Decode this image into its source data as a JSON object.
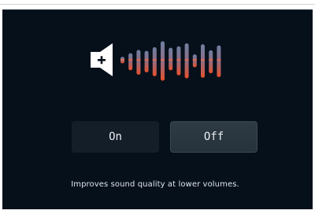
{
  "icons": {
    "speaker": "speaker-plus-icon"
  },
  "visualizer": {
    "bars": [
      {
        "upper": 0.1,
        "lower": 0.12
      },
      {
        "upper": 0.22,
        "lower": 0.35
      },
      {
        "upper": 0.33,
        "lower": 0.5
      },
      {
        "upper": 0.3,
        "lower": 0.42
      },
      {
        "upper": 0.42,
        "lower": 0.55
      },
      {
        "upper": 0.62,
        "lower": 0.7
      },
      {
        "upper": 0.4,
        "lower": 0.35
      },
      {
        "upper": 0.45,
        "lower": 0.52
      },
      {
        "upper": 0.55,
        "lower": 0.62
      },
      {
        "upper": 0.18,
        "lower": 0.25
      },
      {
        "upper": 0.52,
        "lower": 0.6
      },
      {
        "upper": 0.32,
        "lower": 0.45
      },
      {
        "upper": 0.48,
        "lower": 0.58
      }
    ],
    "colors": {
      "upper": "#6e7fa0",
      "lower": "#e8502a",
      "midline": "#ff6a3a"
    }
  },
  "buttons": {
    "on_label": "On",
    "off_label": "Off"
  },
  "description": "Improves sound quality at lower volumes."
}
